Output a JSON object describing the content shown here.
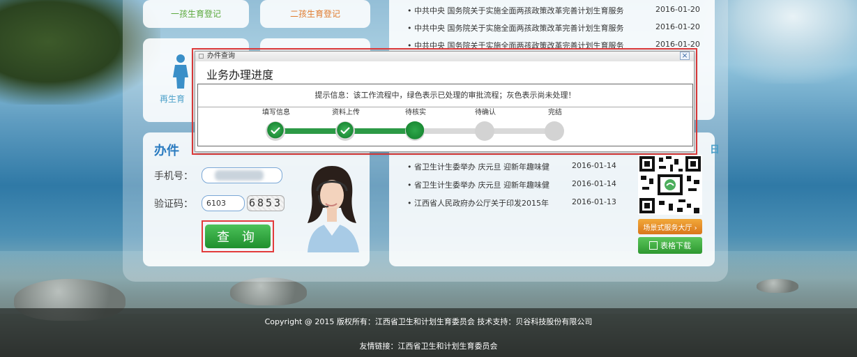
{
  "tiles": {
    "first_child": "一孩生育登记",
    "second_child": "二孩生育登记",
    "remarriage": "再生育"
  },
  "news_top": [
    {
      "title": "中共中央 国务院关于实施全面两孩政策改革完善计划生育服务",
      "date": "2016-01-20"
    },
    {
      "title": "中共中央 国务院关于实施全面两孩政策改革完善计划生育服务",
      "date": "2016-01-20"
    },
    {
      "title": "中共中央 国务院关于实施全面两孩政策改革完善计划生育服务",
      "date": "2016-01-20"
    }
  ],
  "query": {
    "title": "办件",
    "phone_label": "手机号：",
    "code_label": "验证码：",
    "code_value": "6103",
    "captcha": "6853",
    "button": "查 询"
  },
  "news_bottom": [
    {
      "title": "省卫生计生委举办 庆元旦 迎新年趣味健",
      "date": "2016-01-14"
    },
    {
      "title": "省卫生计生委举办 庆元旦 迎新年趣味健",
      "date": "2016-01-14"
    },
    {
      "title": "江西省人民政府办公厅关于印发2015年",
      "date": "2016-01-13"
    }
  ],
  "side": {
    "hall_button": "场景式服务大厅 ›",
    "download_button": "表格下载"
  },
  "dialog": {
    "window_title": "办件查询",
    "close": "×",
    "heading": "业务办理进度",
    "tip": "提示信息：该工作流程中，绿色表示已处理的审批流程；灰色表示尚未处理！",
    "steps": [
      {
        "label": "填写信息",
        "status": "done"
      },
      {
        "label": "资料上传",
        "status": "done"
      },
      {
        "label": "待核实",
        "status": "current"
      },
      {
        "label": "待确认",
        "status": "pending"
      },
      {
        "label": "完结",
        "status": "pending"
      }
    ]
  },
  "footer": {
    "copyright": "Copyright @ 2015 版权所有：江西省卫生和计划生育委员会 技术支持：贝谷科技股份有限公司",
    "links": "友情链接：江西省卫生和计划生育委员会"
  },
  "colors": {
    "accent_green": "#2c9a46",
    "pending_gray": "#d3d3d3",
    "highlight_red": "#e23b3b"
  }
}
